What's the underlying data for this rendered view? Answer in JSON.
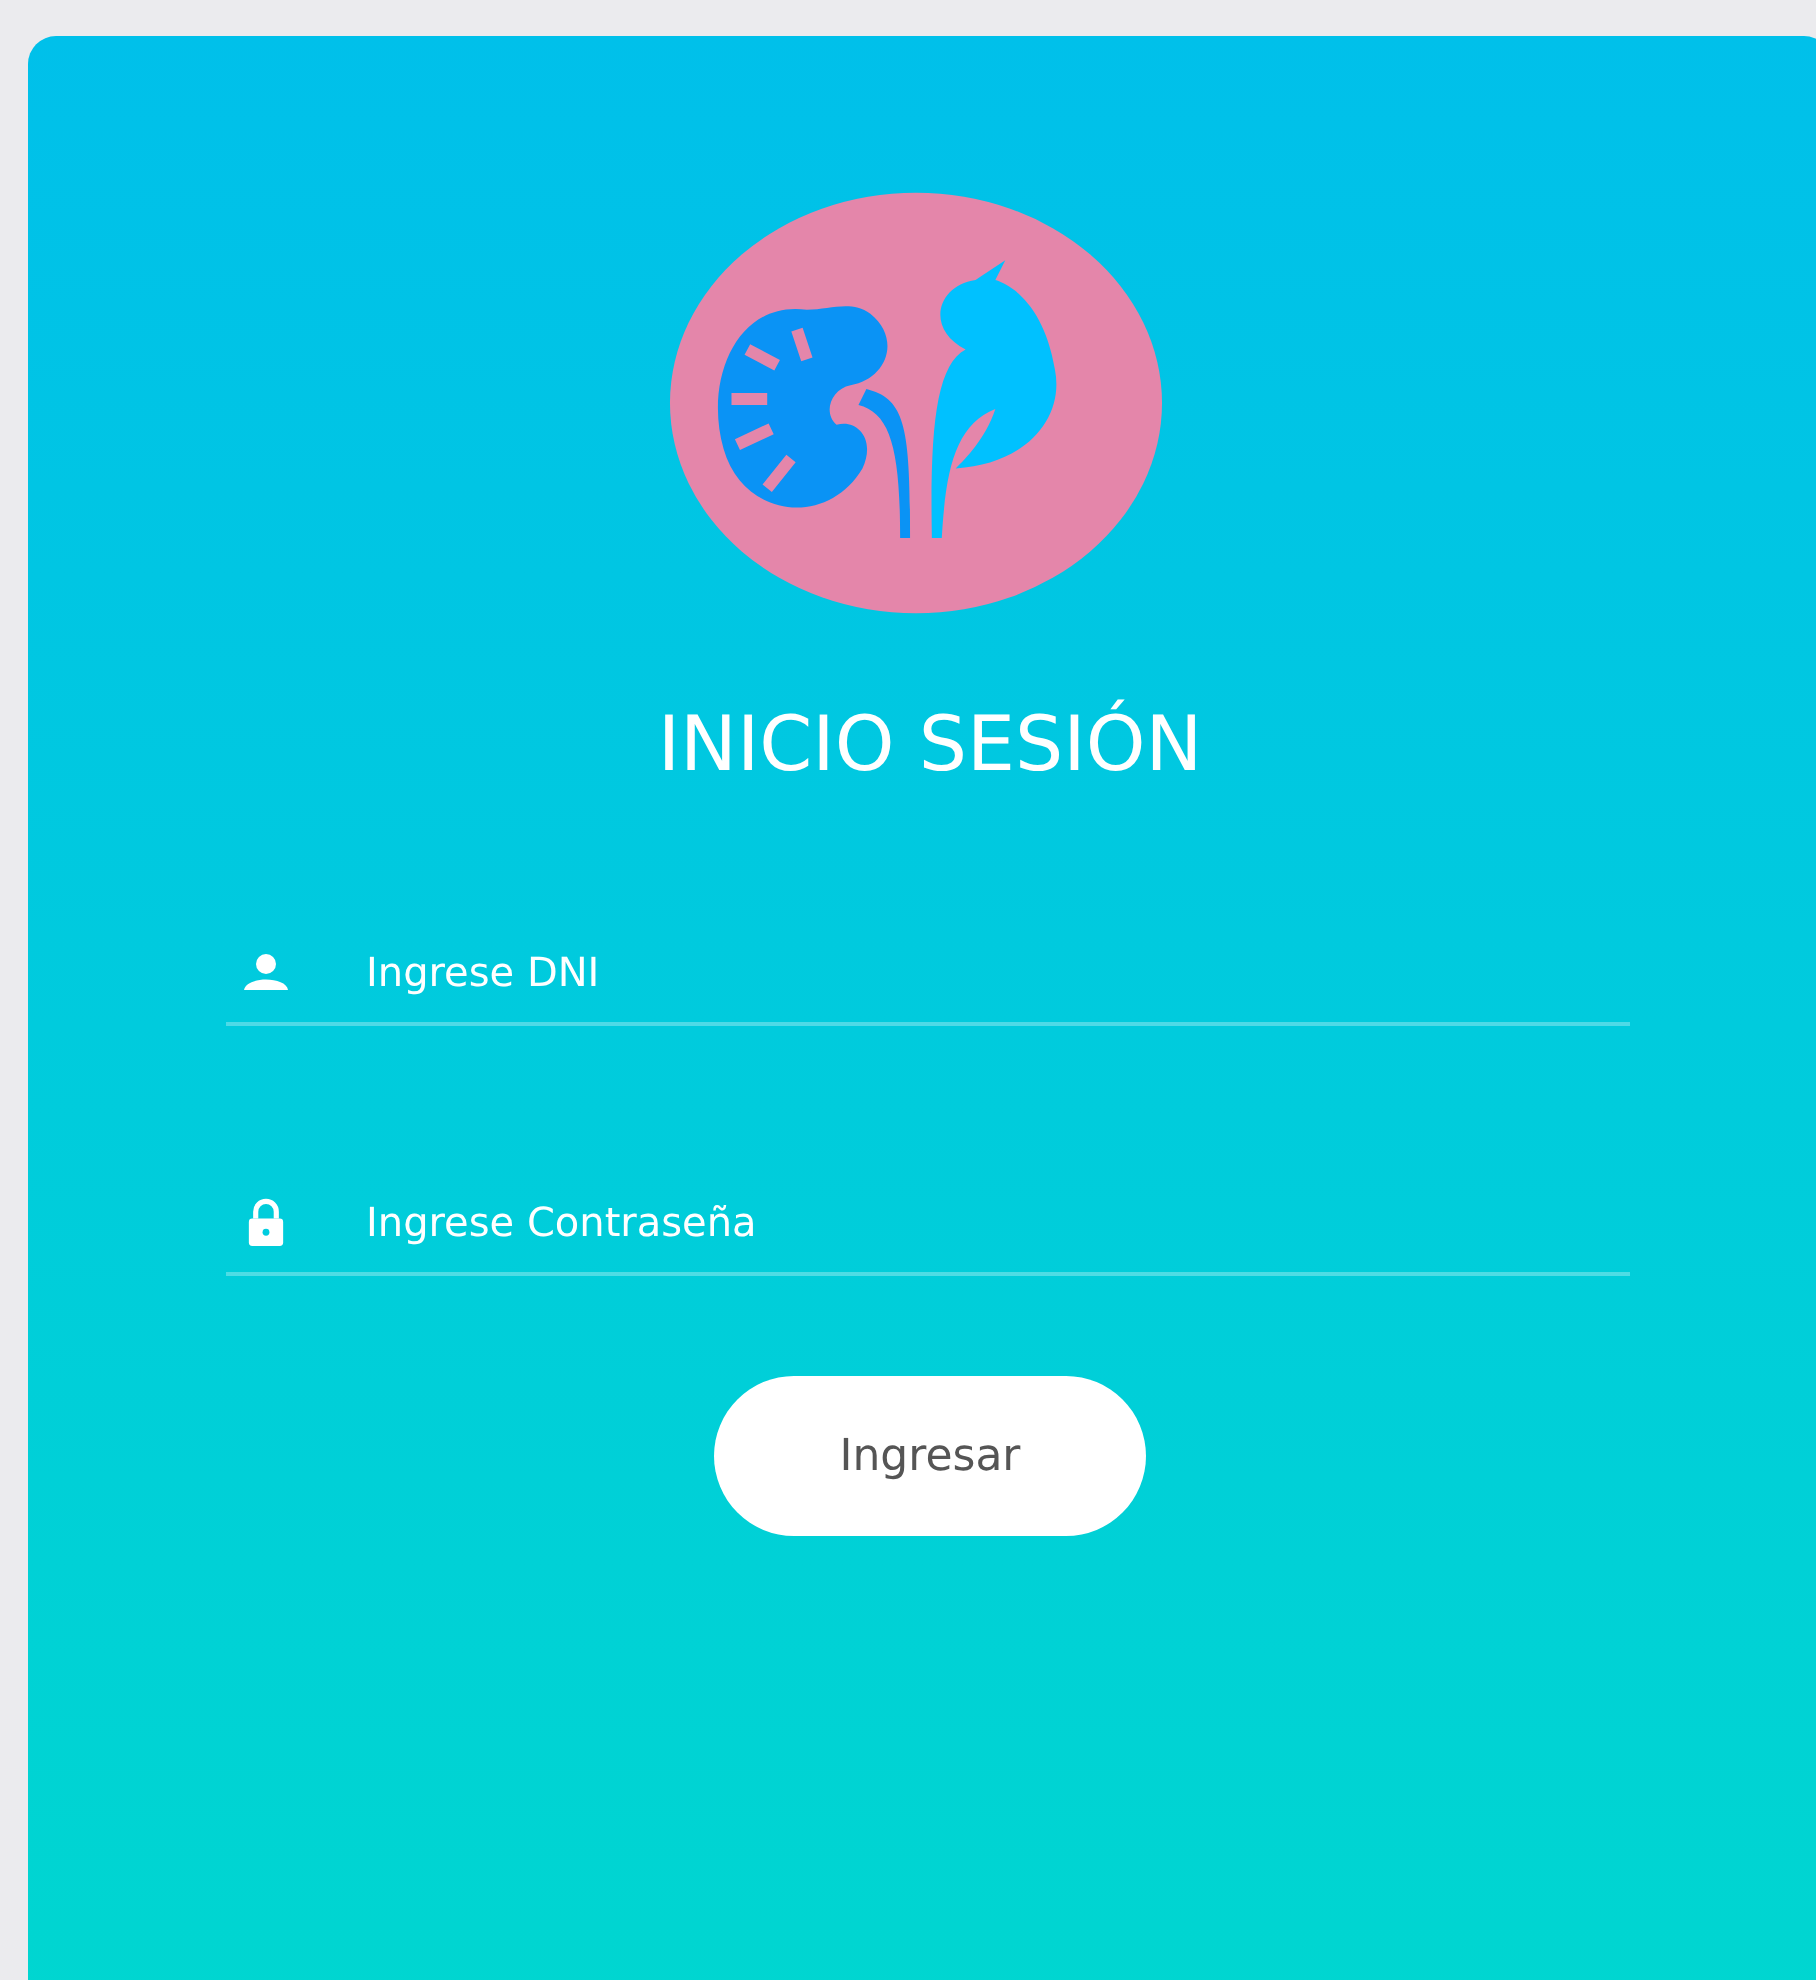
{
  "title": "INICIO SESIÓN",
  "fields": [
    {
      "kind": "user",
      "placeholder": "Ingrese DNI"
    },
    {
      "kind": "lock",
      "placeholder": "Ingrese Contraseña"
    }
  ],
  "button": "Ingresar"
}
